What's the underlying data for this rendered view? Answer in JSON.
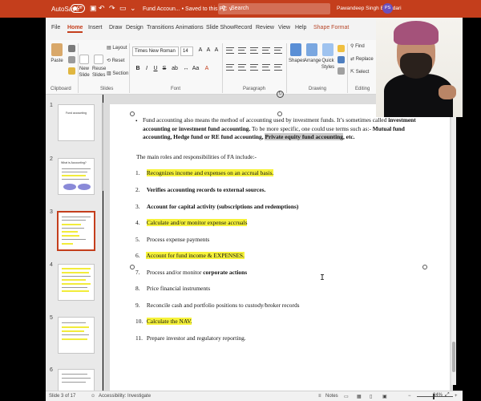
{
  "colors": {
    "accent": "#c43e1c",
    "highlight": "#f6f23a",
    "ribbon_bg": "#f8f8f8"
  },
  "titlebar": {
    "autosave_label": "AutoSave",
    "autosave_state": "Off",
    "document_title": "Fund Accoun... • Saved to this PC ∨",
    "search_placeholder": "Search",
    "user_name": "Pawandeep Singh Bhandari",
    "user_initials": "PS",
    "icons": [
      "save-icon",
      "undo-icon",
      "redo-icon",
      "start-slideshow-icon",
      "more-icon"
    ]
  },
  "tabs": [
    "File",
    "Home",
    "Insert",
    "Draw",
    "Design",
    "Transitions",
    "Animations",
    "Slide Show",
    "Record",
    "Review",
    "View",
    "Help",
    "Shape Format"
  ],
  "ribbon": {
    "clipboard": {
      "paste": "Paste",
      "label": "Clipboard"
    },
    "slides": {
      "new_slide": "New Slide",
      "reuse_slides": "Reuse Slides",
      "layout": "Layout",
      "reset": "Reset",
      "section": "Section",
      "label": "Slides"
    },
    "font": {
      "name": "Times New Roman",
      "size": "14",
      "bold": "B",
      "italic": "I",
      "underline": "U",
      "strike": "S",
      "label": "Font"
    },
    "paragraph": {
      "label": "Paragraph"
    },
    "drawing": {
      "shapes": "Shapes",
      "arrange": "Arrange",
      "quick_styles": "Quick Styles",
      "label": "Drawing"
    },
    "editing": {
      "find": "Find",
      "replace": "Replace",
      "select": "Select",
      "label": "Editing"
    }
  },
  "thumbnails": [
    {
      "num": "1",
      "title": "Fund accounting"
    },
    {
      "num": "2",
      "title": "What is Accounting?"
    },
    {
      "num": "3",
      "title": ""
    },
    {
      "num": "4",
      "title": ""
    },
    {
      "num": "5",
      "title": ""
    },
    {
      "num": "6",
      "title": ""
    }
  ],
  "slide": {
    "bullet": "•",
    "intro_1": "Fund accounting also means the method of accounting used by investment funds. It’s sometimes called ",
    "intro_2": "investment accounting or investment fund accounting.",
    "intro_3": " To be more specific, one could use terms such as:- ",
    "intro_4": "Mutual fund accounting, Hedge fund or RE fund accounting,",
    "intro_5": "Private equity fund accounting",
    "intro_6": ", etc.",
    "roles_heading": "The main roles and responsibilities of FA include:-",
    "items": [
      {
        "num": "1.",
        "text": "Recognizes income and expenses on an accrual basis."
      },
      {
        "num": "2.",
        "text": "Verifies accounting records to external sources."
      },
      {
        "num": "3.",
        "text": "Account for capital activity (subscriptions and redemptions)"
      },
      {
        "num": "4.",
        "text": "Calculate and/or monitor expense accruals"
      },
      {
        "num": "5.",
        "text": "Process expense payments"
      },
      {
        "num": "6.",
        "text": "Account for fund income & EXPENSES."
      },
      {
        "num": "7.",
        "text_plain": "Process and/or monitor ",
        "text_bold": "corporate actions"
      },
      {
        "num": "8.",
        "text": "Price financial instruments"
      },
      {
        "num": "9.",
        "text": "Reconcile cash and portfolio positions to custody/broker records"
      },
      {
        "num": "10.",
        "text": "Calculate the NAV."
      },
      {
        "num": "11.",
        "text": "Prepare investor and regulatory reporting."
      }
    ]
  },
  "statusbar": {
    "slide_counter": "Slide 3 of 17",
    "accessibility": "Accessibility: Investigate",
    "notes": "Notes",
    "zoom": "84%"
  }
}
